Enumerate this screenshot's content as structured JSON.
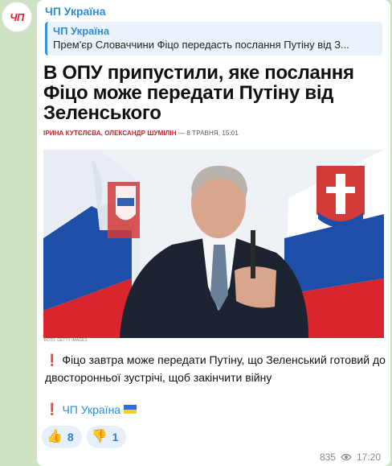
{
  "channel": {
    "avatar_text": "ЧП",
    "name": "ЧП Україна"
  },
  "reply": {
    "name": "ЧП Україна",
    "text": "Прем'єр Словаччини Фіцо передасть послання Путіну від З..."
  },
  "article": {
    "headline": "В ОПУ припустили, яке послання Фіцо може передати Путіну від Зеленського",
    "authors": "ІРИНА КУТЄЛЄВА, ОЛЕКСАНДР ШУМІЛІН",
    "date": "— 8 ТРАВНЯ, 15:01",
    "photo_credit": "ФОТО: GETTY IMAGES"
  },
  "message": {
    "caption_icon": "❗",
    "caption": "Фіцо завтра може передати Путіну, що Зеленський готовий до двосторонньої зустрічі, щоб закінчити війну",
    "signature_icon": "❗",
    "signature": "ЧП Україна"
  },
  "reactions": [
    {
      "emoji": "👍",
      "count": "8"
    },
    {
      "emoji": "👎",
      "count": "1"
    }
  ],
  "meta": {
    "views": "835",
    "time": "17:20"
  },
  "colors": {
    "accent": "#2f8cd6",
    "background": "#cfe3c4",
    "alert_red": "#d9232d"
  }
}
